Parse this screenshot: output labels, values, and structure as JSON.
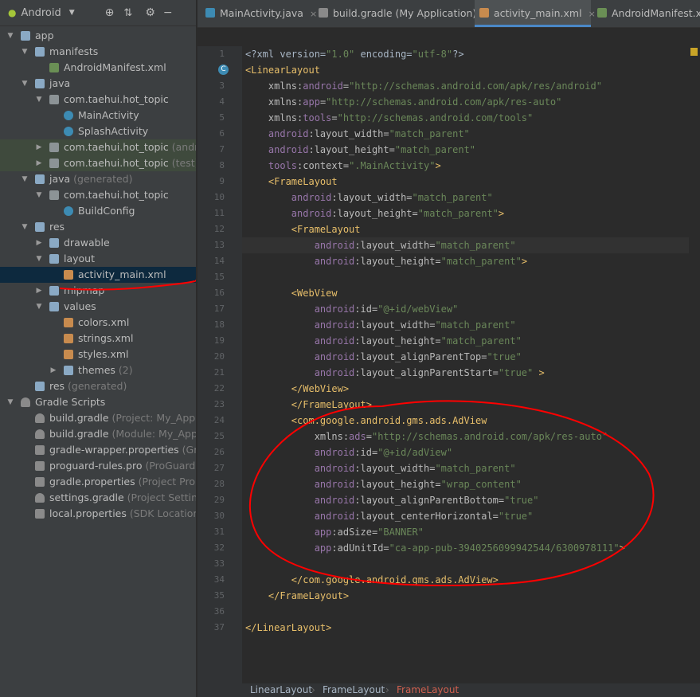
{
  "project_panel": {
    "view_label": "Android",
    "dropdown_arrow": "▼",
    "tree": [
      {
        "label": "app",
        "suffix": "",
        "icon": "module-icon",
        "arrow": "▼",
        "depth": 0
      },
      {
        "label": "manifests",
        "suffix": "",
        "icon": "folder-icon",
        "arrow": "▼",
        "depth": 1
      },
      {
        "label": "AndroidManifest.xml",
        "suffix": "",
        "icon": "manifest-file-icon",
        "arrow": "",
        "depth": 2
      },
      {
        "label": "java",
        "suffix": "",
        "icon": "folder-icon",
        "arrow": "▼",
        "depth": 1
      },
      {
        "label": "com.taehui.hot_topic",
        "suffix": "",
        "icon": "package-icon",
        "arrow": "▼",
        "depth": 2
      },
      {
        "label": "MainActivity",
        "suffix": "",
        "icon": "class-icon",
        "arrow": "",
        "depth": 3
      },
      {
        "label": "SplashActivity",
        "suffix": "",
        "icon": "class-icon",
        "arrow": "",
        "depth": 3
      },
      {
        "label": "com.taehui.hot_topic",
        "suffix": " (androidTest)",
        "icon": "package-icon",
        "arrow": "▶",
        "depth": 2,
        "highlight": true
      },
      {
        "label": "com.taehui.hot_topic",
        "suffix": " (test)",
        "icon": "package-icon",
        "arrow": "▶",
        "depth": 2,
        "highlight": true
      },
      {
        "label": "java",
        "suffix": " (generated)",
        "icon": "generated-folder-icon",
        "arrow": "▼",
        "depth": 1
      },
      {
        "label": "com.taehui.hot_topic",
        "suffix": "",
        "icon": "package-icon",
        "arrow": "▼",
        "depth": 2
      },
      {
        "label": "BuildConfig",
        "suffix": "",
        "icon": "class-icon",
        "arrow": "",
        "depth": 3
      },
      {
        "label": "res",
        "suffix": "",
        "icon": "res-folder-icon",
        "arrow": "▼",
        "depth": 1
      },
      {
        "label": "drawable",
        "suffix": "",
        "icon": "folder-icon",
        "arrow": "▶",
        "depth": 2
      },
      {
        "label": "layout",
        "suffix": "",
        "icon": "folder-icon",
        "arrow": "▼",
        "depth": 2
      },
      {
        "label": "activity_main.xml",
        "suffix": "",
        "icon": "xml-file-icon",
        "arrow": "",
        "depth": 3,
        "selected": true
      },
      {
        "label": "mipmap",
        "suffix": "",
        "icon": "folder-icon",
        "arrow": "▶",
        "depth": 2
      },
      {
        "label": "values",
        "suffix": "",
        "icon": "folder-icon",
        "arrow": "▼",
        "depth": 2
      },
      {
        "label": "colors.xml",
        "suffix": "",
        "icon": "xml-file-icon",
        "arrow": "",
        "depth": 3
      },
      {
        "label": "strings.xml",
        "suffix": "",
        "icon": "xml-file-icon",
        "arrow": "",
        "depth": 3
      },
      {
        "label": "styles.xml",
        "suffix": "",
        "icon": "xml-file-icon",
        "arrow": "",
        "depth": 3
      },
      {
        "label": "themes",
        "suffix": " (2)",
        "icon": "folder-icon",
        "arrow": "▶",
        "depth": 3
      },
      {
        "label": "res",
        "suffix": " (generated)",
        "icon": "res-folder-icon",
        "arrow": "",
        "depth": 1
      },
      {
        "label": "Gradle Scripts",
        "suffix": "",
        "icon": "gradle-icon",
        "arrow": "▼",
        "depth": 0
      },
      {
        "label": "build.gradle",
        "suffix": " (Project: My_Application)",
        "icon": "gradle-icon",
        "arrow": "",
        "depth": 1
      },
      {
        "label": "build.gradle",
        "suffix": " (Module: My_Application.app)",
        "icon": "gradle-icon",
        "arrow": "",
        "depth": 1
      },
      {
        "label": "gradle-wrapper.properties",
        "suffix": " (Gradle Version)",
        "icon": "properties-icon",
        "arrow": "",
        "depth": 1
      },
      {
        "label": "proguard-rules.pro",
        "suffix": " (ProGuard Rules for app)",
        "icon": "properties-icon",
        "arrow": "",
        "depth": 1
      },
      {
        "label": "gradle.properties",
        "suffix": " (Project Properties)",
        "icon": "properties-icon",
        "arrow": "",
        "depth": 1
      },
      {
        "label": "settings.gradle",
        "suffix": " (Project Settings)",
        "icon": "gradle-icon",
        "arrow": "",
        "depth": 1
      },
      {
        "label": "local.properties",
        "suffix": " (SDK Location)",
        "icon": "properties-icon",
        "arrow": "",
        "depth": 1
      }
    ]
  },
  "tabs": [
    {
      "label": "MainActivity.java",
      "icon": "class-icon",
      "active": false
    },
    {
      "label": "build.gradle (My Application)",
      "icon": "gradle-icon",
      "active": false
    },
    {
      "label": "activity_main.xml",
      "icon": "xml-file-icon",
      "active": true
    },
    {
      "label": "AndroidManifest.xml",
      "icon": "manifest-file-icon",
      "active": false
    }
  ],
  "editor": {
    "current_line": 13,
    "lines": [
      [
        [
          "?xml version=",
          "pr"
        ]
      ],
      [
        [
          "<",
          "tg"
        ],
        [
          "LinearLayout",
          "tg"
        ]
      ],
      [
        [
          "    xmlns:",
          "an"
        ],
        [
          "android",
          "ns"
        ],
        [
          "=",
          "an"
        ],
        [
          "\"http://schemas.android.com/apk/res/android\"",
          "av"
        ]
      ],
      [
        [
          "    xmlns:",
          "an"
        ],
        [
          "app",
          "ns"
        ],
        [
          "=",
          "an"
        ],
        [
          "\"http://schemas.android.com/apk/res-auto\"",
          "av"
        ]
      ],
      [
        [
          "    xmlns:",
          "an"
        ],
        [
          "tools",
          "ns"
        ],
        [
          "=",
          "an"
        ],
        [
          "\"http://schemas.android.com/tools\"",
          "av"
        ]
      ],
      [
        [
          "    ",
          "an"
        ],
        [
          "android",
          "ns"
        ],
        [
          ":layout_width=",
          "an"
        ],
        [
          "\"match_parent\"",
          "av"
        ]
      ],
      [
        [
          "    ",
          "an"
        ],
        [
          "android",
          "ns"
        ],
        [
          ":layout_height=",
          "an"
        ],
        [
          "\"match_parent\"",
          "av"
        ]
      ],
      [
        [
          "    ",
          "an"
        ],
        [
          "tools",
          "ns"
        ],
        [
          ":context=",
          "an"
        ],
        [
          "\".MainActivity\"",
          "av"
        ],
        [
          ">",
          "tg"
        ]
      ],
      [
        [
          "    ",
          "an"
        ],
        [
          "<FrameLayout",
          "tg"
        ]
      ],
      [
        [
          "        ",
          "an"
        ],
        [
          "android",
          "ns"
        ],
        [
          ":layout_width=",
          "an"
        ],
        [
          "\"match_parent\"",
          "av"
        ]
      ],
      [
        [
          "        ",
          "an"
        ],
        [
          "android",
          "ns"
        ],
        [
          ":layout_height=",
          "an"
        ],
        [
          "\"match_parent\"",
          "av"
        ],
        [
          ">",
          "tg"
        ]
      ],
      [
        [
          "        ",
          "an"
        ],
        [
          "<FrameLayout",
          "tg"
        ]
      ],
      [
        [
          "            ",
          "an"
        ],
        [
          "android",
          "ns"
        ],
        [
          ":layout_width=",
          "an"
        ],
        [
          "\"match_parent\"",
          "av"
        ]
      ],
      [
        [
          "            ",
          "an"
        ],
        [
          "android",
          "ns"
        ],
        [
          ":layout_height=",
          "an"
        ],
        [
          "\"match_parent\"",
          "av"
        ],
        [
          ">",
          "tg"
        ]
      ],
      [
        [
          "",
          "an"
        ]
      ],
      [
        [
          "        ",
          "an"
        ],
        [
          "<WebView",
          "tg"
        ]
      ],
      [
        [
          "            ",
          "an"
        ],
        [
          "android",
          "ns"
        ],
        [
          ":id=",
          "an"
        ],
        [
          "\"@+id/webView\"",
          "av"
        ]
      ],
      [
        [
          "            ",
          "an"
        ],
        [
          "android",
          "ns"
        ],
        [
          ":layout_width=",
          "an"
        ],
        [
          "\"match_parent\"",
          "av"
        ]
      ],
      [
        [
          "            ",
          "an"
        ],
        [
          "android",
          "ns"
        ],
        [
          ":layout_height=",
          "an"
        ],
        [
          "\"match_parent\"",
          "av"
        ]
      ],
      [
        [
          "            ",
          "an"
        ],
        [
          "android",
          "ns"
        ],
        [
          ":layout_alignParentTop=",
          "an"
        ],
        [
          "\"true\"",
          "av"
        ]
      ],
      [
        [
          "            ",
          "an"
        ],
        [
          "android",
          "ns"
        ],
        [
          ":layout_alignParentStart=",
          "an"
        ],
        [
          "\"true\"",
          "av"
        ],
        [
          " >",
          "tg"
        ]
      ],
      [
        [
          "        ",
          "an"
        ],
        [
          "</WebView>",
          "tg"
        ]
      ],
      [
        [
          "        ",
          "an"
        ],
        [
          "</FrameLayout>",
          "tg"
        ]
      ],
      [
        [
          "        ",
          "an"
        ],
        [
          "<com.google.android.gms.ads.AdView",
          "tg"
        ]
      ],
      [
        [
          "            xmlns:",
          "an"
        ],
        [
          "ads",
          "ns"
        ],
        [
          "=",
          "an"
        ],
        [
          "\"http://schemas.android.com/apk/res-auto\"",
          "av"
        ]
      ],
      [
        [
          "            ",
          "an"
        ],
        [
          "android",
          "ns"
        ],
        [
          ":id=",
          "an"
        ],
        [
          "\"@+id/adView\"",
          "av"
        ]
      ],
      [
        [
          "            ",
          "an"
        ],
        [
          "android",
          "ns"
        ],
        [
          ":layout_width=",
          "an"
        ],
        [
          "\"match_parent\"",
          "av"
        ]
      ],
      [
        [
          "            ",
          "an"
        ],
        [
          "android",
          "ns"
        ],
        [
          ":layout_height=",
          "an"
        ],
        [
          "\"wrap_content\"",
          "av"
        ]
      ],
      [
        [
          "            ",
          "an"
        ],
        [
          "android",
          "ns"
        ],
        [
          ":layout_alignParentBottom=",
          "an"
        ],
        [
          "\"true\"",
          "av"
        ]
      ],
      [
        [
          "            ",
          "an"
        ],
        [
          "android",
          "ns"
        ],
        [
          ":layout_centerHorizontal=",
          "an"
        ],
        [
          "\"true\"",
          "av"
        ]
      ],
      [
        [
          "            ",
          "an"
        ],
        [
          "app",
          "ns"
        ],
        [
          ":adSize=",
          "an"
        ],
        [
          "\"BANNER\"",
          "av"
        ]
      ],
      [
        [
          "            ",
          "an"
        ],
        [
          "app",
          "ns"
        ],
        [
          ":adUnitId=",
          "an"
        ],
        [
          "\"ca-app-pub-3940256099942544/6300978111\"",
          "av"
        ],
        [
          ">",
          "tg"
        ]
      ],
      [
        [
          "",
          "an"
        ]
      ],
      [
        [
          "        ",
          "an"
        ],
        [
          "</com.google.android.gms.ads.AdView>",
          "tg"
        ]
      ],
      [
        [
          "    ",
          "an"
        ],
        [
          "</FrameLayout>",
          "tg"
        ]
      ],
      [
        [
          "",
          "an"
        ]
      ],
      [
        [
          "</LinearLayout>",
          "tg"
        ]
      ]
    ]
  },
  "breadcrumbs": [
    "LinearLayout",
    "FrameLayout",
    "FrameLayout"
  ],
  "colors": {
    "accent": "#4a88c7",
    "annotation": "#ff0000"
  }
}
